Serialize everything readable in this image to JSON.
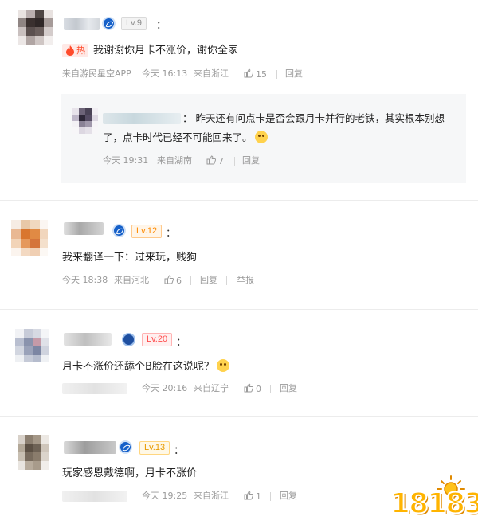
{
  "comments": [
    {
      "level": "Lv.9",
      "hot_label": "热",
      "text": "我谢谢你月卡不涨价，谢你全家",
      "source": "来自游民星空APP",
      "time": "今天 16:13",
      "location": "来自浙江",
      "likes": "15",
      "reply_label": "回复",
      "nested_reply": {
        "text_line1": "：  昨天还有问点卡是否会跟月卡并行的老铁，其实根本别想",
        "text_line2": "了，点卡时代已经不可能回来了。",
        "time": "今天 19:31",
        "location": "来自湖南",
        "likes": "7",
        "reply_label": "回复"
      }
    },
    {
      "level": "Lv.12",
      "text": "我来翻译一下：过来玩，贱狗",
      "time": "今天 18:38",
      "location": "来自河北",
      "likes": "6",
      "reply_label": "回复",
      "report_label": "举报"
    },
    {
      "level": "Lv.20",
      "text": "月卡不涨价还舔个B脸在这说呢？",
      "time": "今天 20:16",
      "location": "来自辽宁",
      "likes": "0",
      "reply_label": "回复"
    },
    {
      "level": "Lv.13",
      "text": "玩家感恩戴德啊，月卡不涨价",
      "time": "今天 19:25",
      "location": "来自浙江",
      "likes": "1",
      "reply_label": "回复"
    }
  ],
  "colon": "：",
  "watermark": "18183",
  "colors": {
    "badge_blue": "#1560c9",
    "hot_red": "#ff4b2b",
    "meta_grey": "#9a9a9a",
    "logo_gold": "#ffb400"
  }
}
